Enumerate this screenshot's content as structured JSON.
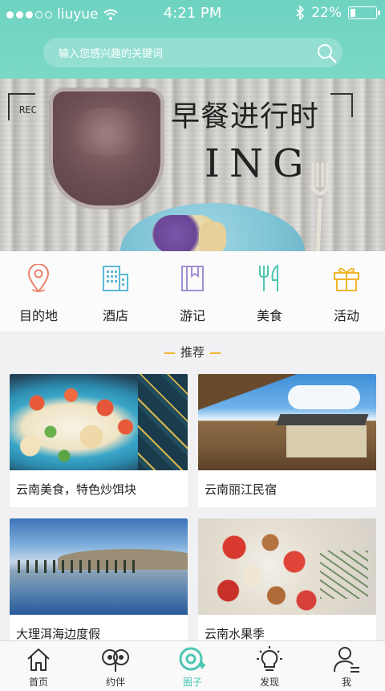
{
  "status_bar": {
    "carrier": "liuyue",
    "time": "4:21 PM",
    "battery": "22%"
  },
  "search": {
    "placeholder": "输入您感兴趣的关键词",
    "icon": "search-icon"
  },
  "banner": {
    "title": "早餐进行时",
    "subtitle": "ING",
    "rec_label": "REC"
  },
  "categories": [
    {
      "label": "目的地",
      "icon": "location-pin-icon",
      "color": "#e9826d"
    },
    {
      "label": "酒店",
      "icon": "building-icon",
      "color": "#5cb8d6"
    },
    {
      "label": "游记",
      "icon": "book-icon",
      "color": "#a18fd0"
    },
    {
      "label": "美食",
      "icon": "fork-knife-icon",
      "color": "#4cc7b2"
    },
    {
      "label": "活动",
      "icon": "gift-icon",
      "color": "#f0b52c"
    }
  ],
  "section": {
    "title": "推荐"
  },
  "cards": [
    {
      "caption": "云南美食，特色炒饵块"
    },
    {
      "caption": "云南丽江民宿"
    },
    {
      "caption": "大理洱海边度假"
    },
    {
      "caption": "云南水果季"
    }
  ],
  "tabbar": {
    "items": [
      {
        "label": "首页",
        "icon": "home-icon"
      },
      {
        "label": "约伴",
        "icon": "companion-icon"
      },
      {
        "label": "圈子",
        "icon": "circle-icon"
      },
      {
        "label": "发现",
        "icon": "lightbulb-icon"
      },
      {
        "label": "我",
        "icon": "user-icon"
      }
    ],
    "active_color": "#4cc7b2"
  },
  "colors": {
    "header": "#72d5c3",
    "accent": "#4cc7b2"
  }
}
